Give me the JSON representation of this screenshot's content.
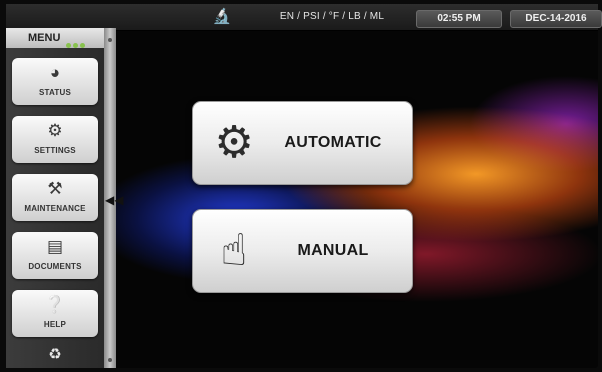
{
  "topbar": {
    "microscope_icon": "microscope-icon",
    "units": "EN / PSI / °F / LB / ML",
    "time": "02:55 PM",
    "date": "DEC-14-2016"
  },
  "sidebar": {
    "menu_title": "MENU",
    "items": [
      {
        "label": "STATUS",
        "icon": "gauge-icon"
      },
      {
        "label": "SETTINGS",
        "icon": "gear-icon"
      },
      {
        "label": "MAINTENANCE",
        "icon": "tools-icon"
      },
      {
        "label": "DOCUMENTS",
        "icon": "document-icon"
      },
      {
        "label": "HELP",
        "icon": "question-icon"
      }
    ],
    "bottom_icon": "recycle-icon",
    "collapse_icon": "double-chevron-left-icon"
  },
  "main": {
    "automatic_label": "AUTOMATIC",
    "automatic_icon": "gears-icon",
    "manual_label": "MANUAL",
    "manual_icon": "hand-pointer-icon"
  },
  "colors": {
    "status_green": "#7ec23a",
    "button_face": "#ececec",
    "bar_dark": "#1a1a1a"
  }
}
